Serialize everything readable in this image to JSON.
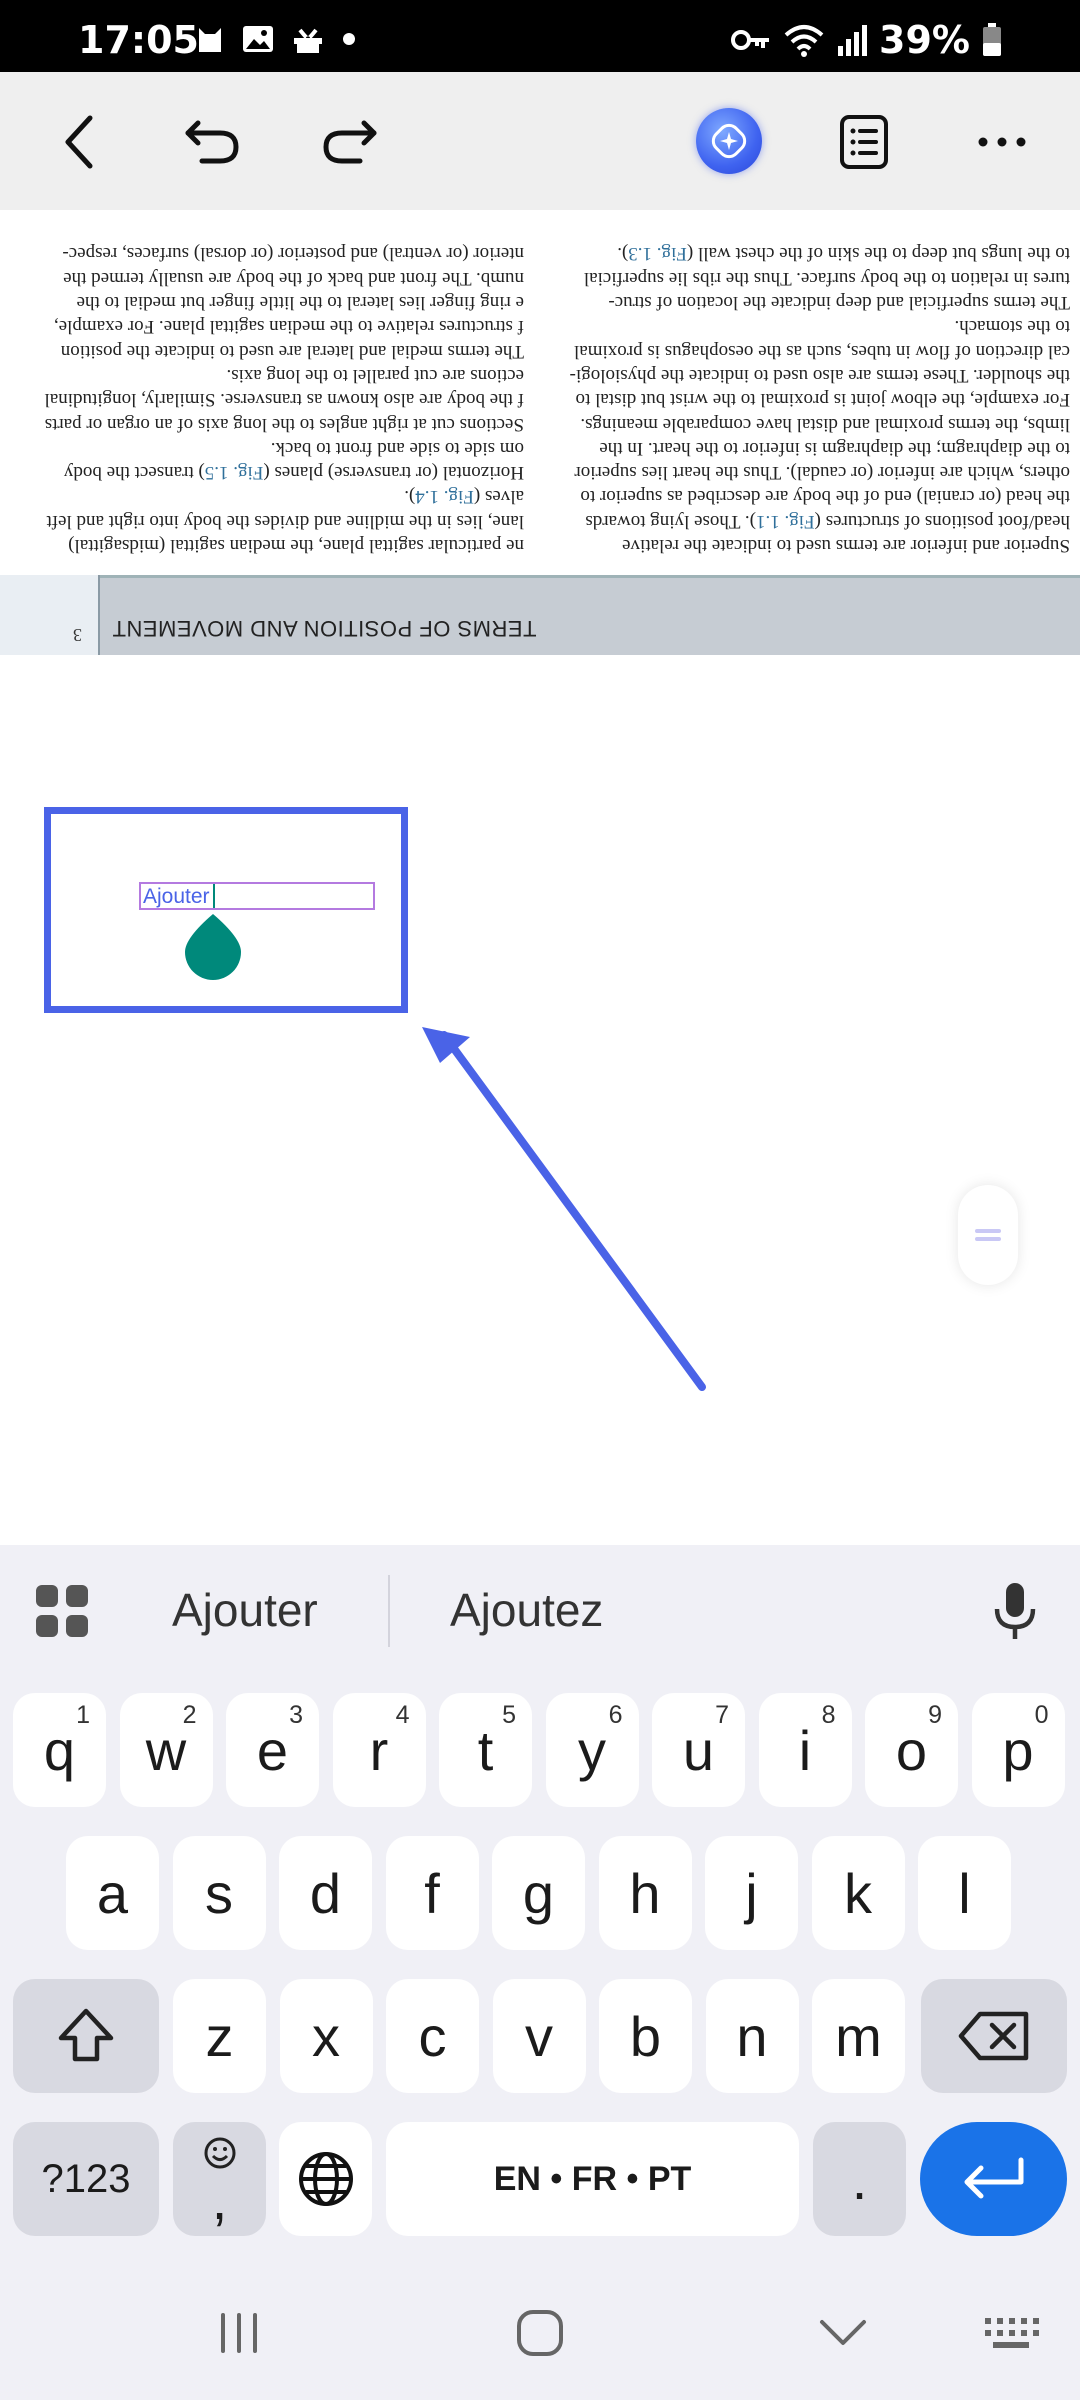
{
  "status_bar": {
    "time": "17:05",
    "battery": "39%"
  },
  "toolbar": {
    "back": "back-icon",
    "undo": "undo-icon",
    "redo": "redo-icon",
    "ai": "ai-assistant-icon",
    "outline": "outline-icon",
    "more": "more-icon"
  },
  "document": {
    "page_number": "3",
    "header_title": "TERMS OF POSITION AND MOVEMENT",
    "left_column": [
      {
        "pre": "to the lungs but deep to the skin of the chest wall (",
        "fig": "Fig. 1.3",
        "post": ")."
      },
      {
        "pre": "tures in relation to the body surface. Thus the ribs lie superficial",
        "fig": "",
        "post": ""
      },
      {
        "pre": "    The terms superficial and deep indicate the location of struc-",
        "fig": "",
        "post": ""
      },
      {
        "pre": "to the stomach.",
        "fig": "",
        "post": ""
      },
      {
        "pre": "cal direction of flow in tubes, such as the oesophagus is proximal",
        "fig": "",
        "post": ""
      },
      {
        "pre": "the shoulder. These terms are also used to indicate the physiologi-",
        "fig": "",
        "post": ""
      },
      {
        "pre": "For example, the elbow joint is proximal to the wrist but distal to",
        "fig": "",
        "post": ""
      },
      {
        "pre": "limbs, the terms proximal and distal have comparable meanings.",
        "fig": "",
        "post": ""
      },
      {
        "pre": "to the diaphragm; the diaphragm is inferior to the heart. In the",
        "fig": "",
        "post": ""
      },
      {
        "pre": "others, which are inferior (or caudal). Thus the heart lies superior",
        "fig": "",
        "post": ""
      },
      {
        "pre": "the head (or cranial) end of the body are described as superior to",
        "fig": "",
        "post": ""
      },
      {
        "pre": "head/foot positions of structures (",
        "fig": "Fig. 1.1",
        "post": "). Those lying towards"
      },
      {
        "pre": "    Superior and inferior are terms used to indicate the relative",
        "fig": "",
        "post": ""
      }
    ],
    "right_column": [
      {
        "pre": "nterior (or ventral) and posterior (or dorsal) surfaces, respec-",
        "fig": "",
        "post": ""
      },
      {
        "pre": "numb. The front and back of the body are usually termed the",
        "fig": "",
        "post": ""
      },
      {
        "pre": "e ring finger lies lateral to the little finger but medial to the",
        "fig": "",
        "post": ""
      },
      {
        "pre": "f structures relative to the median sagittal plane. For example,",
        "fig": "",
        "post": ""
      },
      {
        "pre": "   The terms medial and lateral are used to indicate the position",
        "fig": "",
        "post": ""
      },
      {
        "pre": "ections are cut parallel to the long axis.",
        "fig": "",
        "post": ""
      },
      {
        "pre": "f the body are also known as transverse. Similarly, longitudinal",
        "fig": "",
        "post": ""
      },
      {
        "pre": "   Sections cut at right angles to the long axis of an organ or parts",
        "fig": "",
        "post": ""
      },
      {
        "pre": "om side to side and front to back.",
        "fig": "",
        "post": ""
      },
      {
        "pre": "   Horizontal (or transverse) planes (",
        "fig": "Fig. 1.5",
        "post": ") transect the body"
      },
      {
        "pre": "alves (",
        "fig": "Fig. 1.4",
        "post": ")."
      },
      {
        "pre": "lane, lies in the midline and divides the body into right and left",
        "fig": "",
        "post": ""
      },
      {
        "pre": "ne particular sagittal plane, the median sagittal (midsagittal)",
        "fig": "",
        "post": ""
      }
    ]
  },
  "annotation": {
    "field_value": "Ajouter"
  },
  "keyboard": {
    "suggestions": [
      "Ajouter",
      "Ajoutez"
    ],
    "row1": [
      {
        "label": "q",
        "hint": "1"
      },
      {
        "label": "w",
        "hint": "2"
      },
      {
        "label": "e",
        "hint": "3"
      },
      {
        "label": "r",
        "hint": "4"
      },
      {
        "label": "t",
        "hint": "5"
      },
      {
        "label": "y",
        "hint": "6"
      },
      {
        "label": "u",
        "hint": "7"
      },
      {
        "label": "i",
        "hint": "8"
      },
      {
        "label": "o",
        "hint": "9"
      },
      {
        "label": "p",
        "hint": "0"
      }
    ],
    "row2": [
      "a",
      "s",
      "d",
      "f",
      "g",
      "h",
      "j",
      "k",
      "l"
    ],
    "row3": [
      "z",
      "x",
      "c",
      "v",
      "b",
      "n",
      "m"
    ],
    "symbols_label": "?123",
    "comma_label": ",",
    "space_label": "EN • FR • PT",
    "period_label": "."
  },
  "colors": {
    "accent_blue": "#4a63e7",
    "enter_key": "#1a73e8",
    "field_border": "#b47ae0",
    "cursor_teal": "#00897b"
  }
}
